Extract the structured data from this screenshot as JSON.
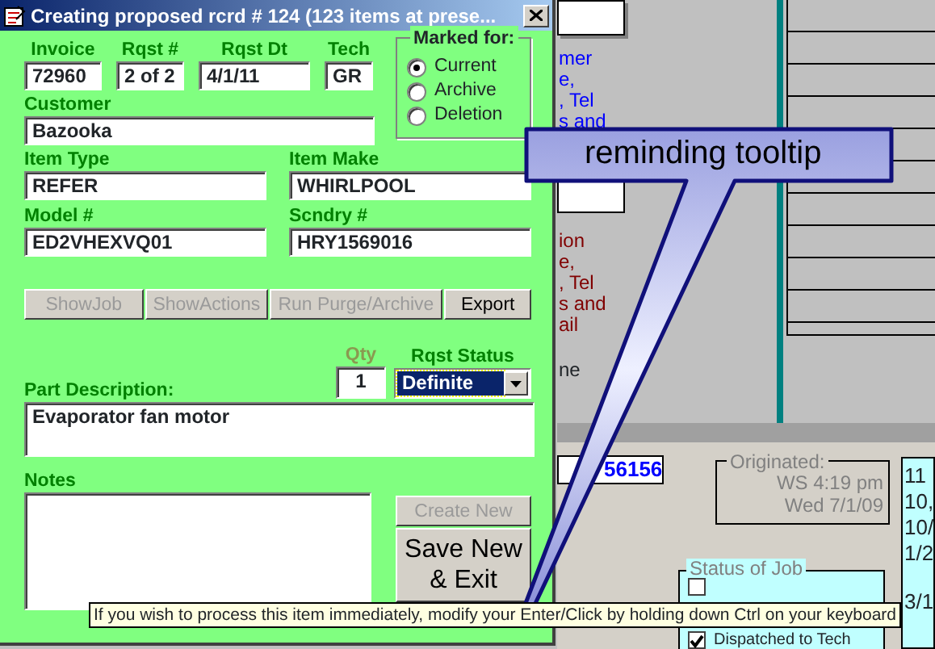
{
  "window": {
    "title": "Creating proposed rcrd # 124  (123 items at prese..."
  },
  "fields_top": [
    {
      "label": "Invoice",
      "value": "72960"
    },
    {
      "label": "Rqst #",
      "value": "2 of 2"
    },
    {
      "label": "Rqst Dt",
      "value": "4/1/11"
    },
    {
      "label": "Tech",
      "value": "GR"
    }
  ],
  "marked_for": {
    "title": "Marked for:",
    "options": [
      {
        "label": "Current",
        "selected": true
      },
      {
        "label": "Archive",
        "selected": false
      },
      {
        "label": "Deletion",
        "selected": false
      }
    ]
  },
  "customer": {
    "label": "Customer",
    "value": "Bazooka"
  },
  "fields_pairs": [
    {
      "label": "Item Type",
      "value": "REFER"
    },
    {
      "label": "Item Make",
      "value": "WHIRLPOOL"
    },
    {
      "label": "Model #",
      "value": "ED2VHEXVQ01"
    },
    {
      "label": "Scndry #",
      "value": "HRY1569016"
    }
  ],
  "actions": [
    {
      "label": "ShowJob",
      "disabled": true
    },
    {
      "label": "ShowActions",
      "disabled": true
    },
    {
      "label": "Run Purge/Archive",
      "disabled": true
    },
    {
      "label": "Export",
      "disabled": false
    }
  ],
  "qty": {
    "label": "Qty",
    "value": "1",
    "disabled": true
  },
  "rqst_status": {
    "label": "Rqst Status",
    "value": "Definite"
  },
  "part_description": {
    "label": "Part Description:",
    "value": "Evaporator fan motor"
  },
  "notes": {
    "label": "Notes"
  },
  "side_buttons": [
    {
      "label": "Create New",
      "disabled": true
    },
    {
      "label": "Save New & Exit",
      "disabled": false
    }
  ],
  "tooltip": "If you wish to process this item immediately, modify your Enter/Click by holding down Ctrl on your keyboard",
  "callout": "reminding tooltip",
  "background_window": {
    "blue_lines": [
      "mer",
      "e,",
      ", Tel",
      "s and"
    ],
    "red_lines": [
      "ion",
      "e,",
      ", Tel",
      "s and",
      "ail"
    ],
    "cut_text": "ne",
    "number": "56156",
    "originated_title": "Originated:",
    "originated_lines": [
      "WS 4:19 pm",
      "Wed 7/1/09"
    ],
    "status_title": "Status of Job",
    "status_items": [
      {
        "checked": false
      },
      {
        "label": "Dispatched to Tech",
        "checked": true
      }
    ],
    "side_lines": [
      "11",
      "10,",
      "10/",
      "1/2",
      "3/1"
    ]
  }
}
